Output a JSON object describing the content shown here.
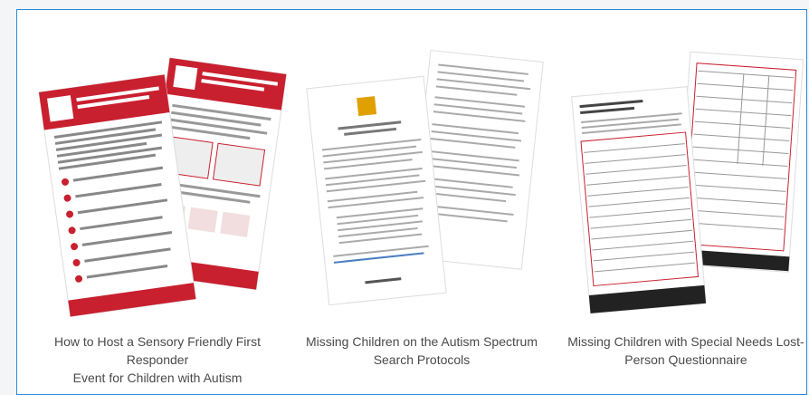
{
  "resources": [
    {
      "title_line1": "How to Host a Sensory Friendly First Responder",
      "title_line2": "Event for Children with Autism",
      "thumbnail": "flyer-thumbnail"
    },
    {
      "title_line1": "Missing Children on the Autism Spectrum",
      "title_line2": "Search Protocols",
      "thumbnail": "document-thumbnail"
    },
    {
      "title_line1": "Missing Children with Special Needs Lost-",
      "title_line2": "Person Questionnaire",
      "thumbnail": "form-thumbnail"
    }
  ],
  "colors": {
    "accent_border": "#2b88d8",
    "flyer_red": "#c8202f",
    "caption_text": "#4a4a4a"
  }
}
